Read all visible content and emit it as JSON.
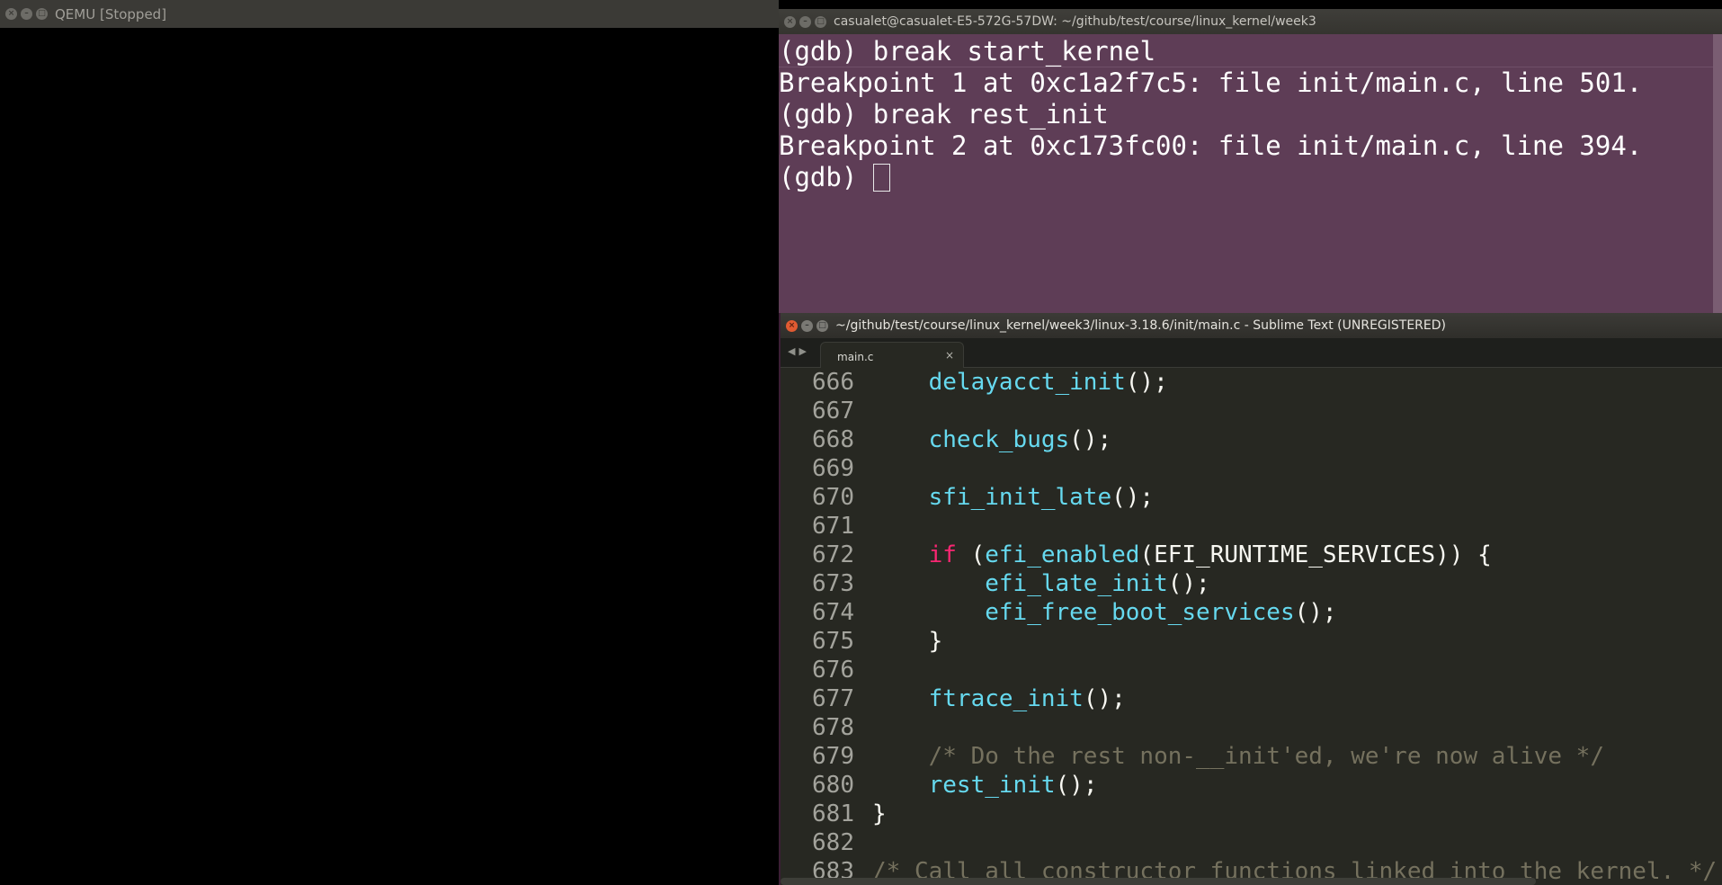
{
  "qemu": {
    "title": "QEMU [Stopped]"
  },
  "terminal": {
    "title": "casualet@casualet-E5-572G-57DW: ~/github/test/course/linux_kernel/week3",
    "lines": [
      "(gdb) break start_kernel",
      "Breakpoint 1 at 0xc1a2f7c5: file init/main.c, line 501.",
      "(gdb) break rest_init",
      "Breakpoint 2 at 0xc173fc00: file init/main.c, line 394.",
      "(gdb) "
    ],
    "background": "#5e3d56"
  },
  "sublime": {
    "title": "~/github/test/course/linux_kernel/week3/linux-3.18.6/init/main.c - Sublime Text (UNREGISTERED)",
    "tab_label": "main.c",
    "tab_close": "×",
    "nav_arrows": "◀▶",
    "line_numbers": [
      "666",
      "667",
      "668",
      "669",
      "670",
      "671",
      "672",
      "673",
      "674",
      "675",
      "676",
      "677",
      "678",
      "679",
      "680",
      "681",
      "682",
      "683"
    ],
    "code": {
      "l666": "delayacct_init",
      "l666_rest": "();",
      "l668": "check_bugs",
      "l668_rest": "();",
      "l670": "sfi_init_late",
      "l670_rest": "();",
      "l672_kw": "if",
      "l672_open": " (",
      "l672_fn": "efi_enabled",
      "l672_rest": "(EFI_RUNTIME_SERVICES)) {",
      "l673": "efi_late_init",
      "l673_rest": "();",
      "l674": "efi_free_boot_services",
      "l674_rest": "();",
      "l675": "}",
      "l677": "ftrace_init",
      "l677_rest": "();",
      "l679": "/* Do the rest non-__init'ed, we're now alive */",
      "l680": "rest_init",
      "l680_rest": "();",
      "l681": "}",
      "l683": "/* Call all constructor functions linked into the kernel. */"
    },
    "colors": {
      "background": "#272822",
      "function": "#66d9ef",
      "keyword": "#f92672",
      "comment": "#75715e",
      "text": "#f8f8f2"
    }
  }
}
